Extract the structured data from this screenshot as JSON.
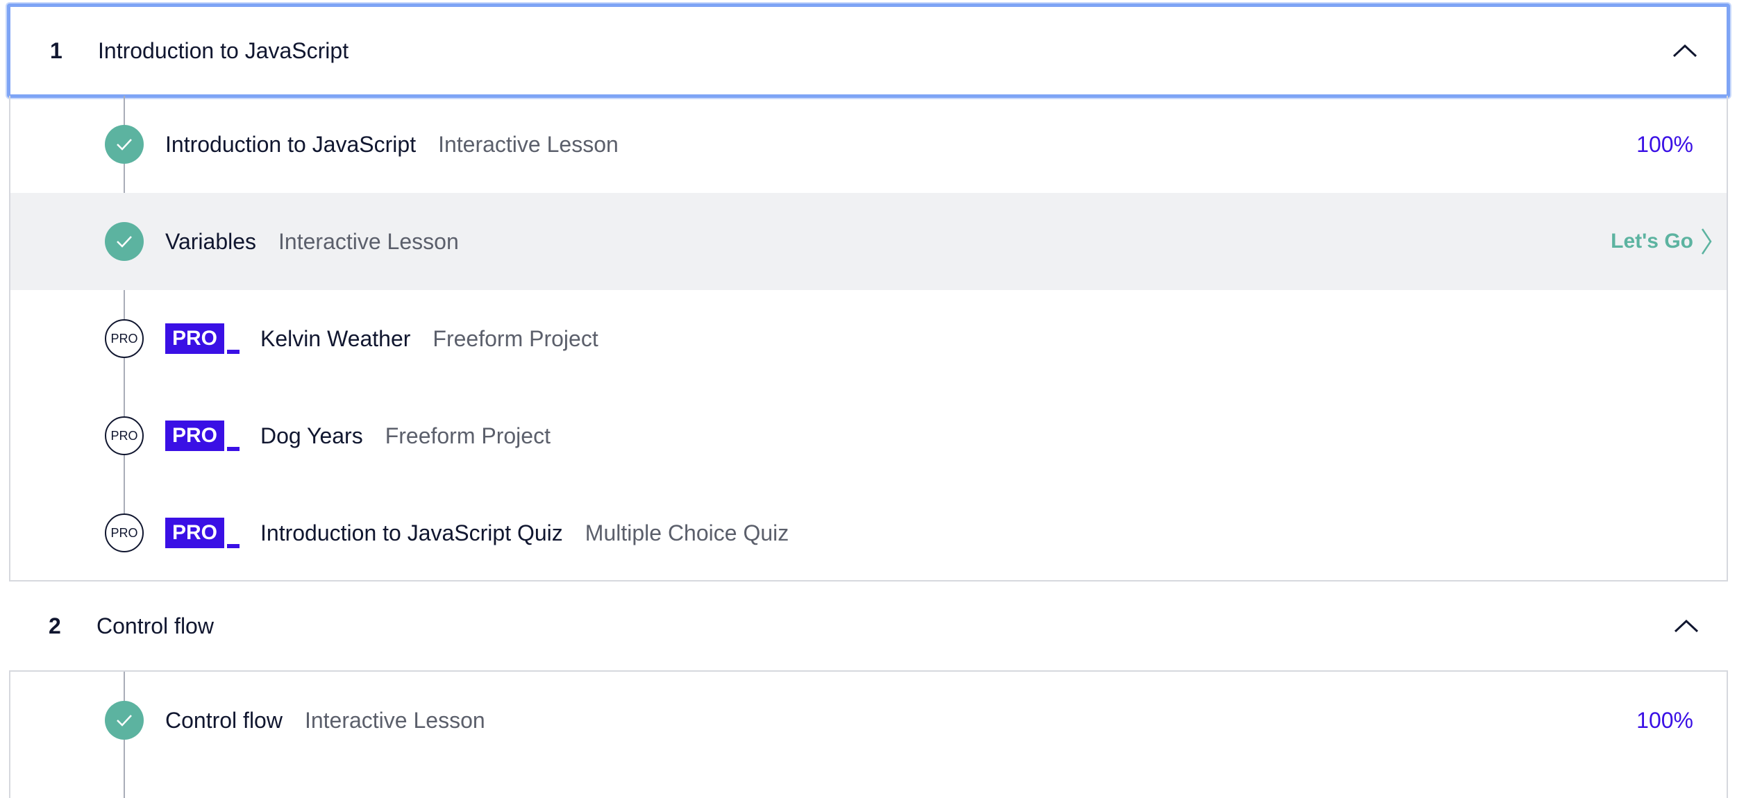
{
  "modules": [
    {
      "number": "1",
      "title": "Introduction to JavaScript",
      "items": [
        {
          "title": "Introduction to JavaScript",
          "type": "Interactive Lesson",
          "status": "complete",
          "progress": "100%"
        },
        {
          "title": "Variables",
          "type": "Interactive Lesson",
          "status": "complete",
          "cta": "Let's Go"
        },
        {
          "title": "Kelvin Weather",
          "type": "Freeform Project",
          "status": "pro",
          "status_label": "PRO",
          "badge": "PRO"
        },
        {
          "title": "Dog Years",
          "type": "Freeform Project",
          "status": "pro",
          "status_label": "PRO",
          "badge": "PRO"
        },
        {
          "title": "Introduction to JavaScript Quiz",
          "type": "Multiple Choice Quiz",
          "status": "pro",
          "status_label": "PRO",
          "badge": "PRO"
        }
      ]
    },
    {
      "number": "2",
      "title": "Control flow",
      "items": [
        {
          "title": "Control flow",
          "type": "Interactive Lesson",
          "status": "complete",
          "progress": "100%"
        }
      ]
    }
  ],
  "colors": {
    "complete": "#5cb3a0",
    "pro_badge": "#3a10e5",
    "progress_text": "#3a10e5",
    "focus_ring": "#7ea4f5",
    "hover_row": "#f0f1f3"
  },
  "icons": {
    "collapse": "chevron-up-icon",
    "complete": "check-icon",
    "cta": "chevron-right-icon"
  }
}
